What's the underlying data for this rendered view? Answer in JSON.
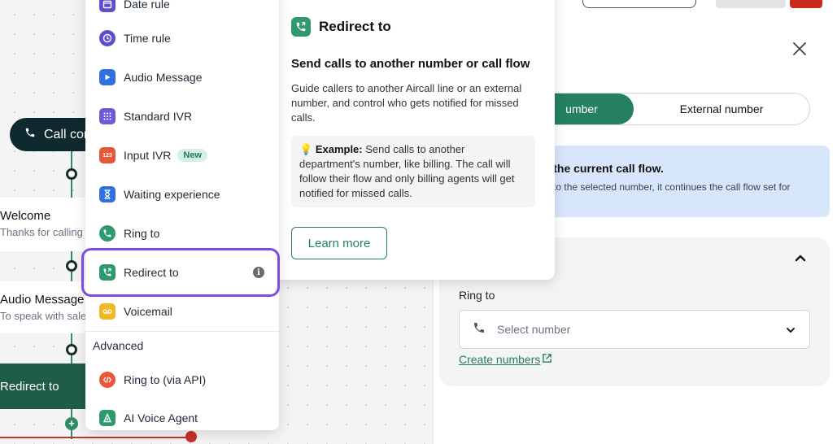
{
  "canvas": {
    "call_pill_label": "Call con",
    "nodes": [
      {
        "title": "Welcome",
        "subtitle": "Thanks for calling"
      },
      {
        "title": "Audio Message",
        "subtitle": "To speak with sale"
      }
    ],
    "redirect_node_label": "Redirect to",
    "plus_symbol": "+"
  },
  "menu": {
    "items": [
      {
        "label": "Date rule",
        "icon": "calendar-icon",
        "color": "#5b4fcf"
      },
      {
        "label": "Time rule",
        "icon": "clock-icon",
        "color": "#5b4fcf"
      },
      {
        "label": "Audio Message",
        "icon": "play-icon",
        "color": "#2f6fe0"
      },
      {
        "label": "Standard IVR",
        "icon": "keypad-icon",
        "color": "#6b5bd6"
      },
      {
        "label": "Input IVR",
        "icon": "input-123-icon",
        "color": "#e8573a",
        "badge": "New",
        "icon_text": "123"
      },
      {
        "label": "Waiting experience",
        "icon": "hourglass-icon",
        "color": "#2f6fe0"
      },
      {
        "label": "Ring to",
        "icon": "phone-ring-icon",
        "color": "#2e9a6d"
      },
      {
        "label": "Redirect to",
        "icon": "redirect-icon",
        "color": "#2e9a6d"
      },
      {
        "label": "Voicemail",
        "icon": "voicemail-icon",
        "color": "#f2b922"
      }
    ],
    "advanced_heading": "Advanced",
    "advanced_items": [
      {
        "label": "Ring to (via API)",
        "icon": "code-icon",
        "color": "#e8573a"
      },
      {
        "label": "AI Voice Agent",
        "icon": "ai-agent-icon",
        "color": "#2e9a6d"
      }
    ],
    "info_symbol": "i"
  },
  "tooltip": {
    "title": "Redirect to",
    "heading": "Send calls to another number or call flow",
    "description": "Guide callers to another Aircall line or an external number, and control who gets notified for missed calls.",
    "example_emoji": "💡",
    "example_label": "Example:",
    "example_text": " Send calls to another department's number, like billing. The call will follow their flow and only billing agents will get notified for missed calls.",
    "learn_more": "Learn more"
  },
  "panel": {
    "segment_left": "umber",
    "segment_right": "External number",
    "info_heading": "ds the current call flow.",
    "info_text": "ent to the selected number, it continues the call flow set for",
    "ring_to_label": "Ring to",
    "select_placeholder": "Select number",
    "create_link": "Create numbers"
  },
  "colors": {
    "accent": "#24805f",
    "highlight": "#7c4ddb",
    "danger": "#c92a1b"
  }
}
